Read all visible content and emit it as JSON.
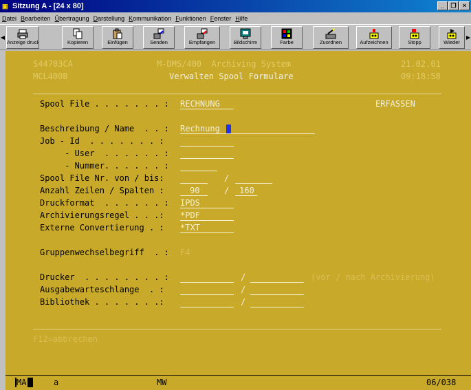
{
  "window": {
    "title": "Sitzung A - [24 x 80]"
  },
  "menu": [
    "Datei",
    "Bearbeiten",
    "Übertragung",
    "Darstellung",
    "Kommunikation",
    "Funktionen",
    "Fenster",
    "Hilfe"
  ],
  "toolbar": {
    "anzeige_drucken": "Anzeige drucken",
    "kopieren": "Kopieren",
    "einfuegen": "Einfügen",
    "senden": "Senden",
    "empfangen": "Empfangen",
    "bildschirm": "Bildschirm",
    "farbe": "Farbe",
    "zuordnen": "Zuordnen",
    "aufzeichnen": "Aufzeichnen",
    "stopp": "Stopp",
    "wieder": "Wieder"
  },
  "screen": {
    "system_id": "S44703CA",
    "program": "MCL400B",
    "app_title": "M-DMS/400  Archiving System",
    "subtitle": "Verwalten Spool Formulare",
    "date": "21.02.01",
    "time": "09:18:58",
    "spool_file_label": "Spool File . . . . . . . :",
    "spool_file_value": "RECHNUNG",
    "mode": "ERFASSEN",
    "labels": {
      "beschreibung": "Beschreibung / Name  . . :",
      "job_id": "Job - Id  . . . . . . . :",
      "user": "     - User  . . . . . . :",
      "nummer": "     - Nummer. . . . . . :",
      "spool_nr": "Spool File Nr. von / bis:",
      "zeilen_spalten": "Anzahl Zeilen / Spalten :",
      "druckformat": "Druckformat  . . . . . . :",
      "archivierungsregel": "Archivierungsregel . . .:",
      "externe_convertierung": "Externe Convertierung . :",
      "gruppenwechsel": "Gruppenwechselbegriff  . :",
      "drucker": "Drucker  . . . . . . . . :",
      "ausgabewarteschlange": "Ausgabewarteschlange  . :",
      "bibliothek": "Bibliothek . . . . . . .:"
    },
    "values": {
      "beschreibung": "Rechnung",
      "zeilen": "90",
      "spalten": "160",
      "druckformat": "IPDS",
      "archivierungsregel": "*PDF",
      "externe_convertierung": "*TXT",
      "gruppenwechsel": "F4"
    },
    "slash": "/",
    "drucker_hint": "(vor / nach Archivierung)",
    "fkeys": "F12=abbrechen"
  },
  "statusbar": {
    "session": "MA",
    "mode_char": "a",
    "mw": "MW",
    "cursor_pos": "06/038"
  },
  "colors": {
    "screen_bg": "#c8a92a",
    "title_bar": "#000080",
    "cursor": "#2233ee"
  }
}
